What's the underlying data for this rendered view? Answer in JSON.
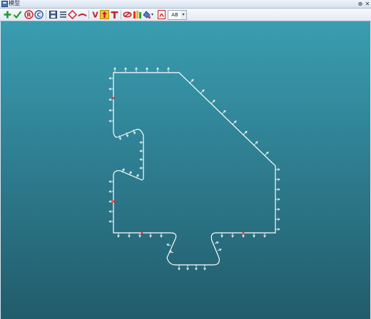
{
  "window": {
    "title": "模型",
    "pin_glyph": "⊕",
    "close_glyph": "✕"
  },
  "toolbar": {
    "tools": [
      {
        "name": "add-icon",
        "tooltip": ""
      },
      {
        "name": "check-icon",
        "tooltip": ""
      },
      {
        "name": "r-circle-icon",
        "tooltip": ""
      },
      {
        "name": "c-circle-icon",
        "tooltip": ""
      },
      {
        "name": "save-icon",
        "tooltip": ""
      },
      {
        "name": "list-icon",
        "tooltip": ""
      },
      {
        "name": "diamond-icon",
        "tooltip": ""
      },
      {
        "name": "arc-icon",
        "tooltip": ""
      },
      {
        "name": "v-icon",
        "tooltip": ""
      },
      {
        "name": "arrow-up-icon",
        "tooltip": ""
      },
      {
        "name": "t-icon",
        "tooltip": ""
      },
      {
        "name": "link-icon",
        "tooltip": ""
      },
      {
        "name": "bars-icon",
        "tooltip": ""
      },
      {
        "name": "paint-icon",
        "tooltip": ""
      },
      {
        "name": "pdf-icon",
        "tooltip": ""
      }
    ],
    "text_selector_value": "AB",
    "dropdown_glyph": "▾"
  },
  "colors": {
    "outline": "#ffffff",
    "load_arrow": "#ffffff",
    "marker": "#e0202a",
    "canvas_top": "#3a9db0",
    "canvas_bottom": "#215c6b"
  }
}
